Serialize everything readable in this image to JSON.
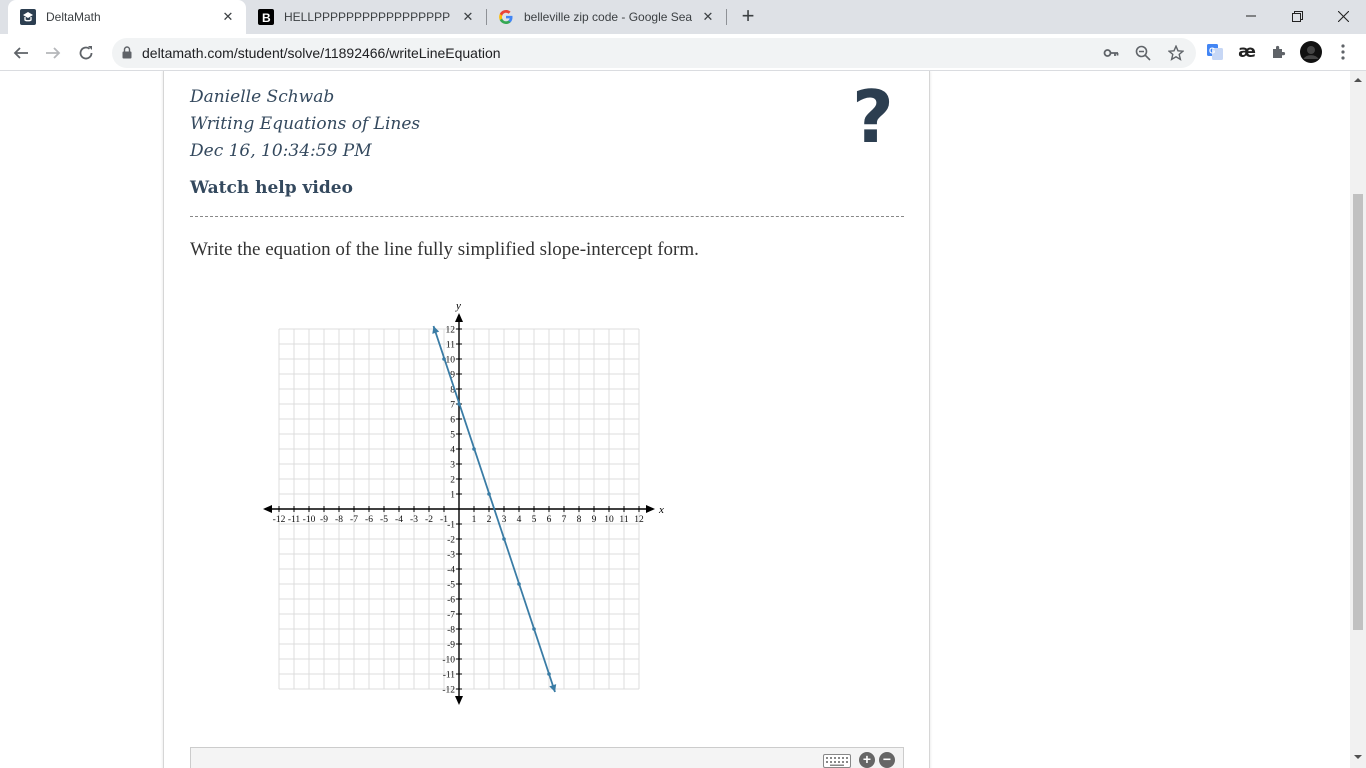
{
  "browser": {
    "tabs": [
      {
        "title": "DeltaMath",
        "active": true
      },
      {
        "title": "HELLPPPPPPPPPPPPPPPPP PLZZZZZ",
        "active": false
      },
      {
        "title": "belleville zip code - Google Search",
        "active": false
      }
    ],
    "url": "deltamath.com/student/solve/11892466/writeLineEquation"
  },
  "page": {
    "student_name": "Danielle Schwab",
    "assignment": "Writing Equations of Lines",
    "timestamp": "Dec 16, 10:34:59 PM",
    "help_link": "Watch help video",
    "help_icon": "?",
    "question": "Write the equation of the line fully simplified slope-intercept form."
  },
  "chart_data": {
    "type": "line",
    "xlabel": "x",
    "ylabel": "y",
    "xlim": [
      -12,
      12
    ],
    "ylim": [
      -12,
      12
    ],
    "grid": true,
    "x_tick_labels": [
      -12,
      -11,
      -10,
      -9,
      -8,
      -7,
      -6,
      -5,
      -4,
      -3,
      -2,
      -1,
      1,
      2,
      3,
      4,
      5,
      6,
      7,
      8,
      9,
      10,
      11,
      12
    ],
    "y_tick_labels": [
      -12,
      -11,
      -10,
      -9,
      -8,
      -7,
      -6,
      -5,
      -4,
      -3,
      -2,
      -1,
      1,
      2,
      3,
      4,
      5,
      6,
      7,
      8,
      9,
      10,
      11,
      12
    ],
    "line": {
      "x1": -1.7,
      "y1": 12.2,
      "x2": 6.4,
      "y2": -12.2,
      "color": "#3a7ca5"
    },
    "marked_points": [
      [
        -1,
        10
      ],
      [
        0,
        7
      ],
      [
        1,
        4
      ],
      [
        2,
        1
      ],
      [
        3,
        -2
      ],
      [
        4,
        -5
      ],
      [
        5,
        -8
      ],
      [
        6,
        -11
      ]
    ]
  }
}
